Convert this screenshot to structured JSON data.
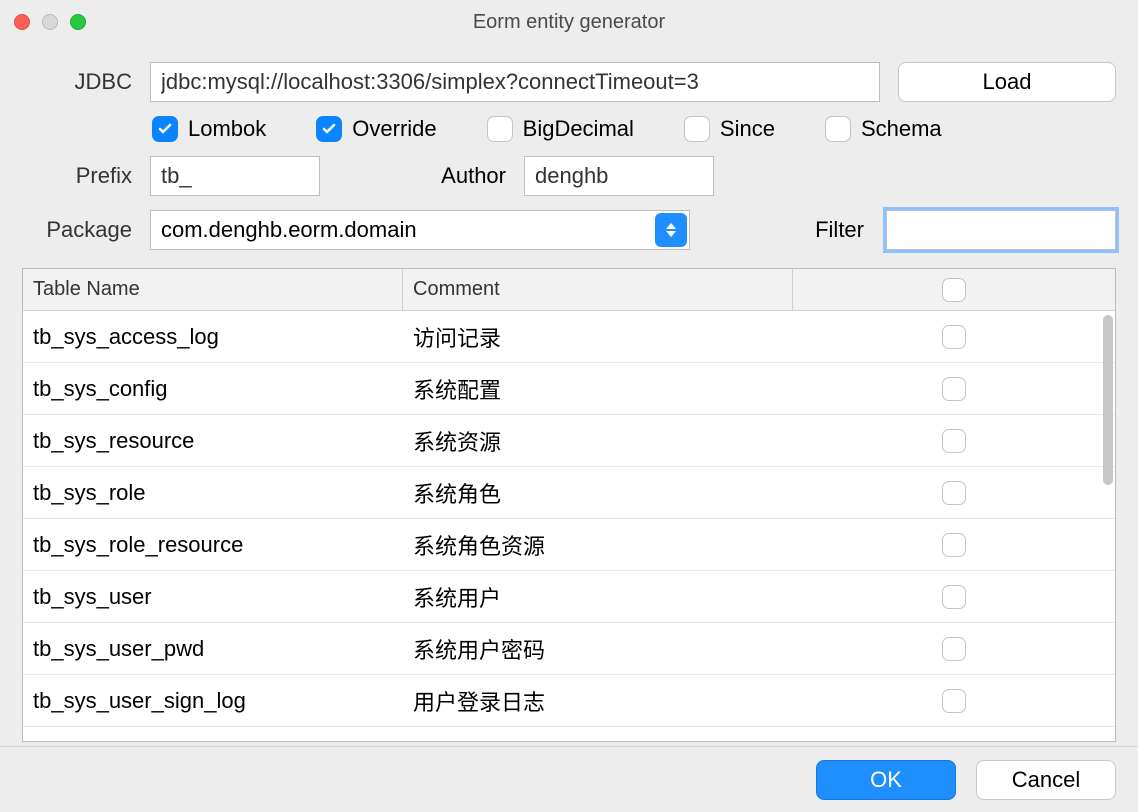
{
  "window": {
    "title": "Eorm entity generator"
  },
  "jdbc": {
    "label": "JDBC",
    "value": "jdbc:mysql://localhost:3306/simplex?connectTimeout=3",
    "load_button": "Load"
  },
  "options": {
    "lombok": {
      "label": "Lombok",
      "checked": true
    },
    "override": {
      "label": "Override",
      "checked": true
    },
    "bigdecimal": {
      "label": "BigDecimal",
      "checked": false
    },
    "since": {
      "label": "Since",
      "checked": false
    },
    "schema": {
      "label": "Schema",
      "checked": false
    }
  },
  "prefix": {
    "label": "Prefix",
    "value": "tb_"
  },
  "author": {
    "label": "Author",
    "value": "denghb"
  },
  "package": {
    "label": "Package",
    "value": "com.denghb.eorm.domain"
  },
  "filter": {
    "label": "Filter",
    "value": ""
  },
  "table": {
    "headers": {
      "name": "Table Name",
      "comment": "Comment"
    },
    "rows": [
      {
        "name": "tb_sys_access_log",
        "comment": "访问记录",
        "checked": false
      },
      {
        "name": "tb_sys_config",
        "comment": "系统配置",
        "checked": false
      },
      {
        "name": "tb_sys_resource",
        "comment": "系统资源",
        "checked": false
      },
      {
        "name": "tb_sys_role",
        "comment": "系统角色",
        "checked": false
      },
      {
        "name": "tb_sys_role_resource",
        "comment": "系统角色资源",
        "checked": false
      },
      {
        "name": "tb_sys_user",
        "comment": "系统用户",
        "checked": false
      },
      {
        "name": "tb_sys_user_pwd",
        "comment": "系统用户密码",
        "checked": false
      },
      {
        "name": "tb_sys_user_sign_log",
        "comment": "用户登录日志",
        "checked": false
      }
    ]
  },
  "footer": {
    "ok": "OK",
    "cancel": "Cancel"
  }
}
